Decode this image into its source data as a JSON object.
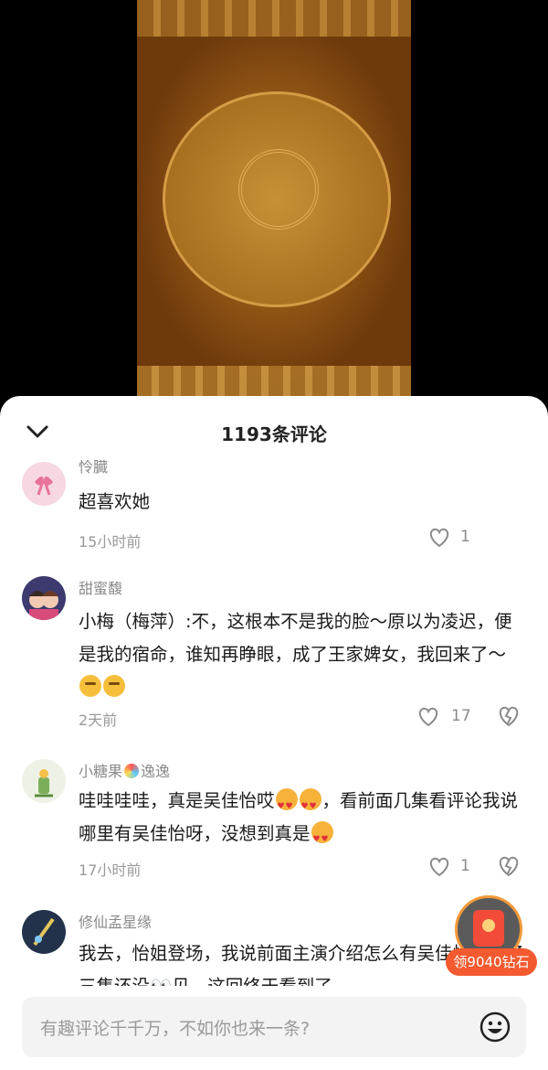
{
  "sheet": {
    "title": "1193条评论"
  },
  "comments": [
    {
      "user": "怜臓",
      "text": "超喜欢她",
      "time": "15小时前",
      "likes": "1"
    },
    {
      "user": "甜蜜馥",
      "text": "小梅（梅萍）:不，这根本不是我的脸～原以为凌迟，便是我的宿命，谁知再睁眼，成了王家婢女，我回来了～",
      "time": "2天前",
      "likes": "17"
    },
    {
      "user_a": "小糖果",
      "user_b": "逸逸",
      "text_a": "哇哇哇哇，真是吴佳怡哎",
      "text_b": "，看前面几集看评论我说哪里有吴佳怡呀，没想到真是",
      "time": "17小时前",
      "likes": "1"
    },
    {
      "user": "修仙孟星缘",
      "text": "我去，怡姐登场，我说前面主演介绍怎么有吴佳怡，看了三集还没👀见，这回终于看到了"
    }
  ],
  "reward": {
    "label": "领9040钻石"
  },
  "input": {
    "placeholder": "有趣评论千千万，不如你也来一条?"
  },
  "icons": [
    "chevron-down-icon",
    "heart-icon",
    "dislike-icon",
    "smile-icon",
    "red-envelope-icon"
  ],
  "colors": {
    "accent": "#f35a2f",
    "text": "#1b1b1b",
    "muted": "#9a9a9a"
  }
}
